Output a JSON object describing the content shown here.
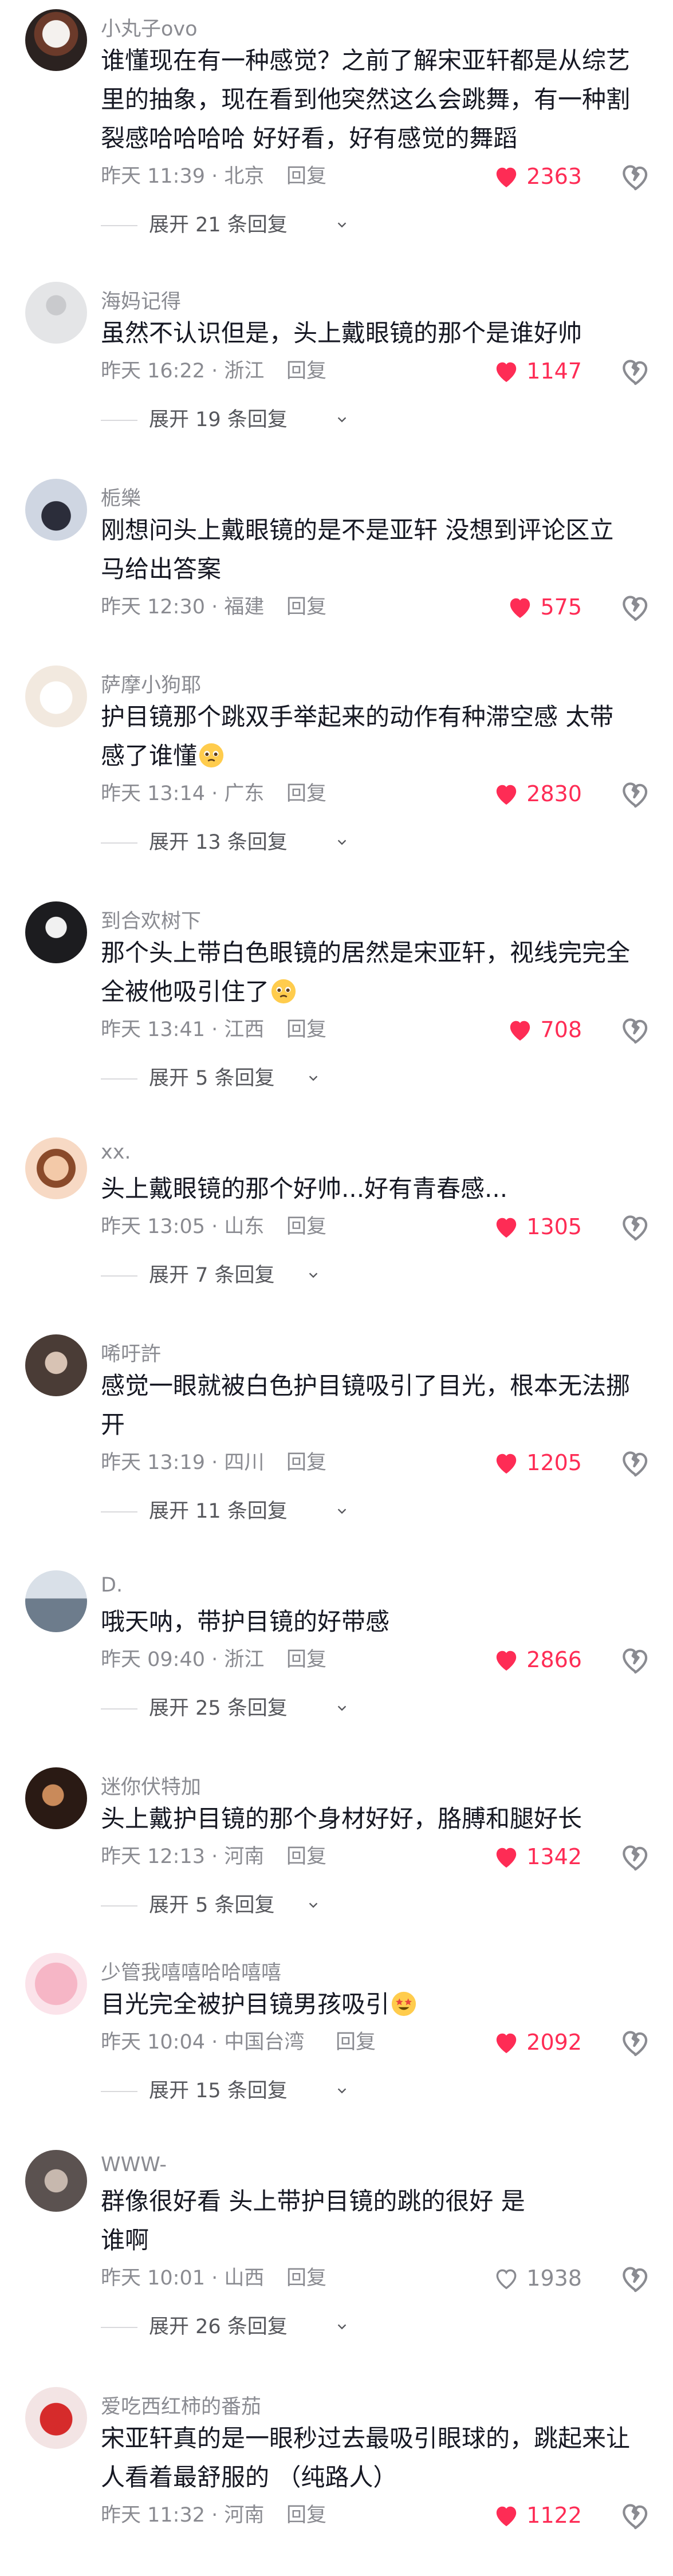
{
  "reply_label": "回复",
  "comments": [
    {
      "username": "小丸子ovo",
      "lines": [
        "谁懂现在有一种感觉？之前了解宋亚轩都是从综艺",
        "里的抽象，现在看到他突然这么会跳舞，有一种割",
        "裂感哈哈哈哈 好好看，好有感觉的舞蹈"
      ],
      "meta": "昨天 11:39 · 北京",
      "likes": "2363",
      "liked": true,
      "expand": "展开 21 条回复"
    },
    {
      "username": "海妈记得",
      "lines": [
        "虽然不认识但是，头上戴眼镜的那个是谁好帅"
      ],
      "meta": "昨天 16:22 · 浙江",
      "likes": "1147",
      "liked": true,
      "expand": "展开 19 条回复"
    },
    {
      "username": "栀樂",
      "lines": [
        "刚想问头上戴眼镜的是不是亚轩 没想到评论区立",
        "马给出答案"
      ],
      "meta": "昨天 12:30 · 福建",
      "likes": "575",
      "liked": true,
      "expand": ""
    },
    {
      "username": "萨摩小狗耶",
      "lines": [
        "护目镜那个跳双手举起来的动作有种滞空感 太带",
        "感了谁懂"
      ],
      "meta": "昨天 13:14 · 广东",
      "likes": "2830",
      "liked": true,
      "expand": "展开 13 条回复"
    },
    {
      "username": "到合欢树下",
      "lines": [
        "那个头上带白色眼镜的居然是宋亚轩，视线完完全",
        "全被他吸引住了"
      ],
      "meta": "昨天 13:41 · 江西",
      "likes": "708",
      "liked": true,
      "expand": "展开 5 条回复"
    },
    {
      "username": "xx.",
      "lines": [
        "头上戴眼镜的那个好帅...好有青春感..."
      ],
      "meta": "昨天 13:05 · 山东",
      "likes": "1305",
      "liked": true,
      "expand": "展开 7 条回复"
    },
    {
      "username": "唏吁許",
      "lines": [
        "感觉一眼就被白色护目镜吸引了目光，根本无法挪",
        "开"
      ],
      "meta": "昨天 13:19 · 四川",
      "likes": "1205",
      "liked": true,
      "expand": "展开 11 条回复"
    },
    {
      "username": "D.",
      "lines": [
        "哦天呐，带护目镜的好带感"
      ],
      "meta": "昨天 09:40 · 浙江",
      "likes": "2866",
      "liked": true,
      "expand": "展开 25 条回复"
    },
    {
      "username": "迷你伏特加",
      "lines": [
        "头上戴护目镜的那个身材好好，胳膊和腿好长"
      ],
      "meta": "昨天 12:13 · 河南",
      "likes": "1342",
      "liked": true,
      "expand": "展开 5 条回复"
    },
    {
      "username": "少管我嘻嘻哈哈嘻嘻",
      "lines": [
        "目光完全被护目镜男孩吸引"
      ],
      "meta": "昨天 10:04 · 中国台湾",
      "likes": "2092",
      "liked": true,
      "expand": "展开 15 条回复"
    },
    {
      "username": "WWW-",
      "lines": [
        "群像很好看 头上带护目镜的跳的很好 是",
        "谁啊"
      ],
      "meta": "昨天 10:01 · 山西",
      "likes": "1938",
      "liked": false,
      "expand": "展开 26 条回复"
    },
    {
      "username": "爱吃西红柿的番茄",
      "lines": [
        "宋亚轩真的是一眼秒过去最吸引眼球的，跳起来让",
        "人看着最舒服的 （纯路人）"
      ],
      "meta": "昨天 11:32 · 河南",
      "likes": "1122",
      "liked": true,
      "expand": ""
    }
  ]
}
